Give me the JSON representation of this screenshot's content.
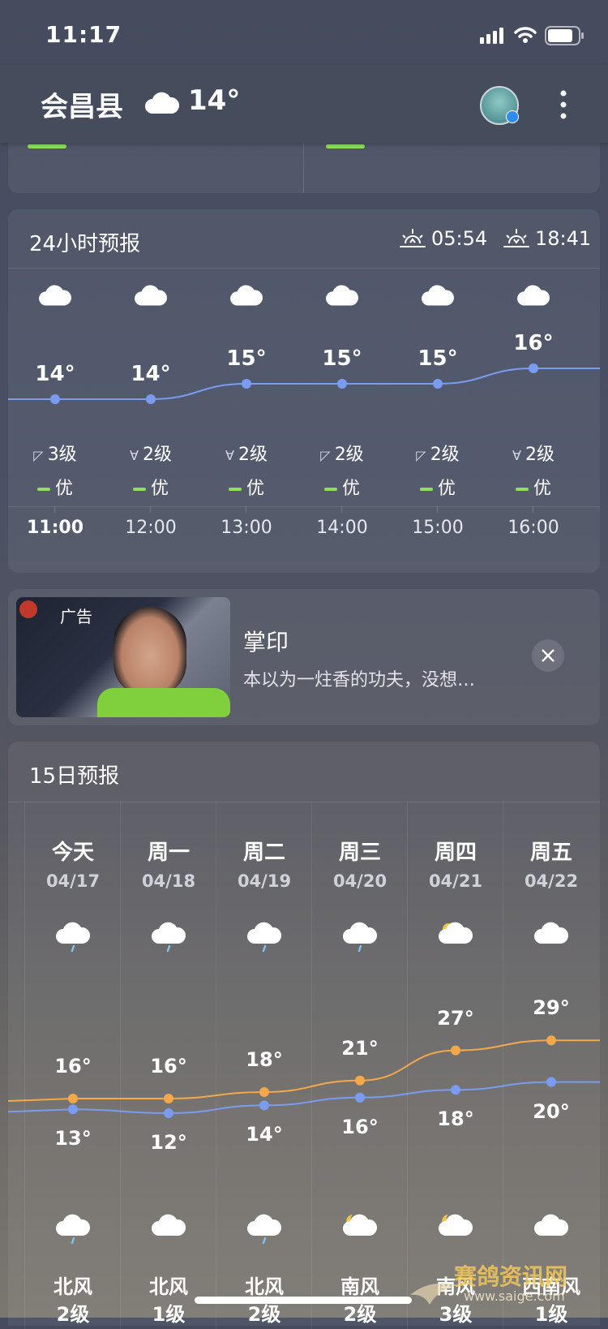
{
  "status_bar": {
    "time": "11:17"
  },
  "header": {
    "city": "会昌县",
    "current_temp": "14°"
  },
  "hourly": {
    "title": "24小时预报",
    "sunrise": "05:54",
    "sunset": "18:41",
    "hours": [
      {
        "time": "11:00",
        "temp": "14°",
        "wind": "3级",
        "aq": "优"
      },
      {
        "time": "12:00",
        "temp": "14°",
        "wind": "2级",
        "aq": "优"
      },
      {
        "time": "13:00",
        "temp": "15°",
        "wind": "2级",
        "aq": "优"
      },
      {
        "time": "14:00",
        "temp": "15°",
        "wind": "2级",
        "aq": "优"
      },
      {
        "time": "15:00",
        "temp": "15°",
        "wind": "2级",
        "aq": "优"
      },
      {
        "time": "16:00",
        "temp": "16°",
        "wind": "2级",
        "aq": "优"
      }
    ]
  },
  "ad": {
    "badge": "广告",
    "title": "掌印",
    "desc": "本以为一炷香的功夫，没想…"
  },
  "daily": {
    "title": "15日预报",
    "days": [
      {
        "name": "今天",
        "date": "04/17",
        "high": "16°",
        "low": "13°",
        "wind": "北风",
        "level": "2级"
      },
      {
        "name": "周一",
        "date": "04/18",
        "high": "16°",
        "low": "12°",
        "wind": "北风",
        "level": "1级"
      },
      {
        "name": "周二",
        "date": "04/19",
        "high": "18°",
        "low": "14°",
        "wind": "北风",
        "level": "2级"
      },
      {
        "name": "周三",
        "date": "04/20",
        "high": "21°",
        "low": "16°",
        "wind": "南风",
        "level": "2级"
      },
      {
        "name": "周四",
        "date": "04/21",
        "high": "27°",
        "low": "18°",
        "wind": "南风",
        "level": "3级"
      },
      {
        "name": "周五",
        "date": "04/22",
        "high": "29°",
        "low": "20°",
        "wind": "西南风",
        "level": "1级"
      }
    ]
  },
  "watermark": {
    "text": "赛鸽资讯网",
    "url": "www.saige.com"
  },
  "colors": {
    "high_line": "#f5a849",
    "low_line": "#7a9cf0",
    "hour_line": "#7a9cf0",
    "aq_good": "#8ee05a"
  }
}
